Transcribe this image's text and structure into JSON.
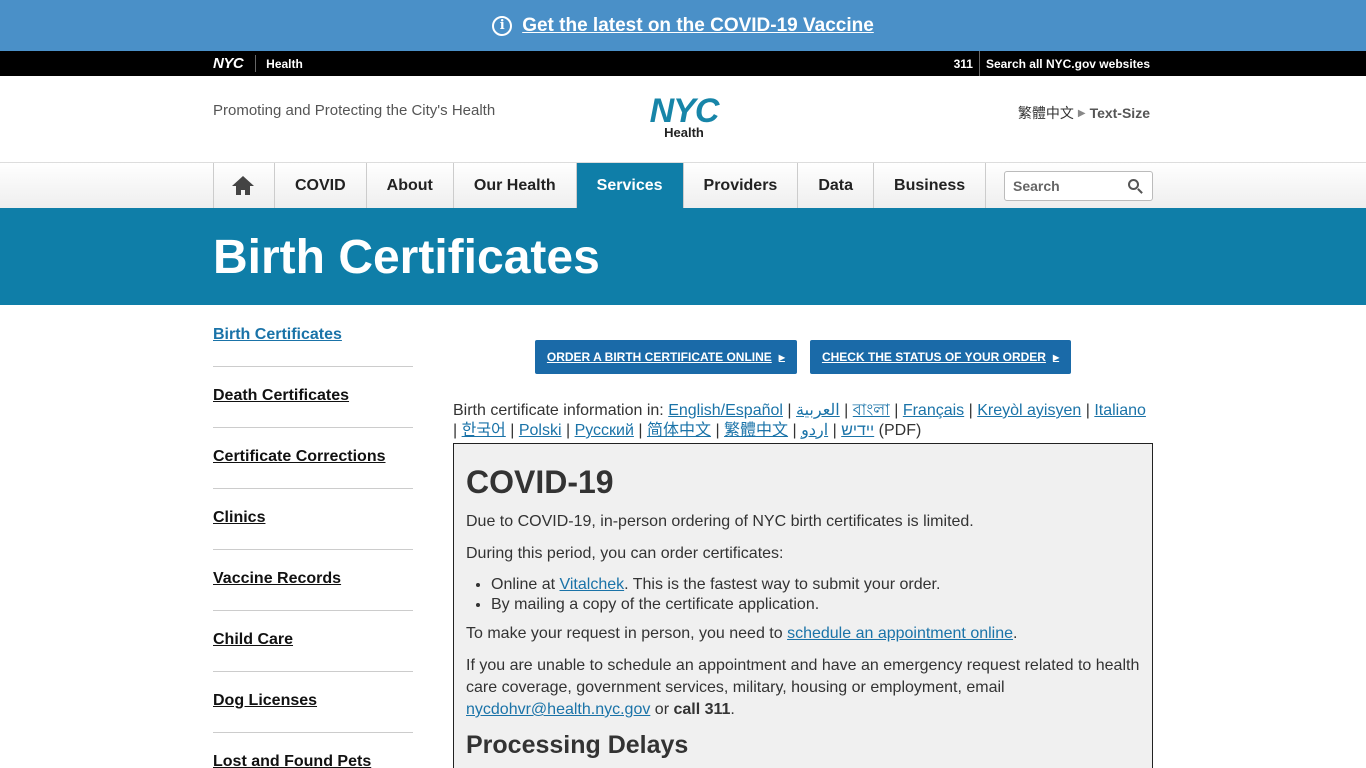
{
  "alert": {
    "icon": "info-circle-icon",
    "link_text": "Get the latest on the COVID-19 Vaccine"
  },
  "topbar": {
    "nyc": "NYC",
    "section": "Health",
    "num_311": "311",
    "search_all": "Search all NYC.gov websites"
  },
  "header": {
    "tagline": "Promoting and Protecting the City's Health",
    "logo_nyc": "NYC",
    "logo_health": "Health",
    "language": "繁體中文",
    "text_size": "Text-Size"
  },
  "nav": {
    "items": [
      "COVID",
      "About",
      "Our Health",
      "Services",
      "Providers",
      "Data",
      "Business"
    ],
    "active": "Services",
    "search_placeholder": "Search"
  },
  "page_title": "Birth Certificates",
  "sidebar": {
    "items": [
      "Birth Certificates",
      "Death Certificates",
      "Certificate Corrections",
      "Clinics",
      "Vaccine Records",
      "Child Care",
      "Dog Licenses",
      "Lost and Found Pets"
    ]
  },
  "buttons": {
    "order": "ORDER A BIRTH CERTIFICATE ONLINE",
    "status": "CHECK THE STATUS OF YOUR ORDER"
  },
  "languages": {
    "intro": "Birth certificate information in:",
    "links": [
      "English/Español",
      "العربية",
      "বাংলা",
      "Français",
      "Kreyòl ayisyen",
      "Italiano",
      "한국어",
      "Polski",
      "Русский",
      "简体中文",
      "繁體中文",
      "יידיש",
      "اردو"
    ],
    "suffix": "(PDF)"
  },
  "covid": {
    "title": "COVID-19",
    "p1": "Due to COVID-19, in-person ordering of NYC birth certificates is limited.",
    "p2": "During this period, you can order certificates:",
    "li1_pre": "Online at ",
    "li1_link": "Vitalchek",
    "li1_post": ". This is the fastest way to submit your order.",
    "li2": "By mailing a copy of the certificate application.",
    "p3_pre": "To make your request in person, you need to ",
    "p3_link": "schedule an appointment online",
    "p3_post": ".",
    "p4_pre": "If you are unable to schedule an appointment and have an emergency request related to health care coverage, government services, military, housing or employment, email ",
    "p4_email": "nycdohvr@health.nyc.gov",
    "p4_mid": " or ",
    "p4_call": "call 311",
    "p4_post": ".",
    "subtitle": "Processing Delays"
  }
}
